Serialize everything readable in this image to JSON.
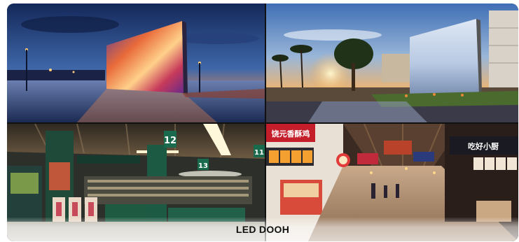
{
  "caption": "LED DOOH",
  "tiles": [
    {
      "name": "waterfront-led-screen-night"
    },
    {
      "name": "resort-led-screen-sunset"
    },
    {
      "name": "supermarket-led-signage",
      "aisle_numbers": [
        "12",
        "13",
        "11"
      ]
    },
    {
      "name": "food-court-led-signage",
      "signs": [
        "饶元香酥鸡",
        "吃好小厨"
      ]
    }
  ],
  "colors": {
    "caption_text": "#111111",
    "sky_night": "#1d3a73",
    "sky_sunset": "#f2a75a"
  }
}
